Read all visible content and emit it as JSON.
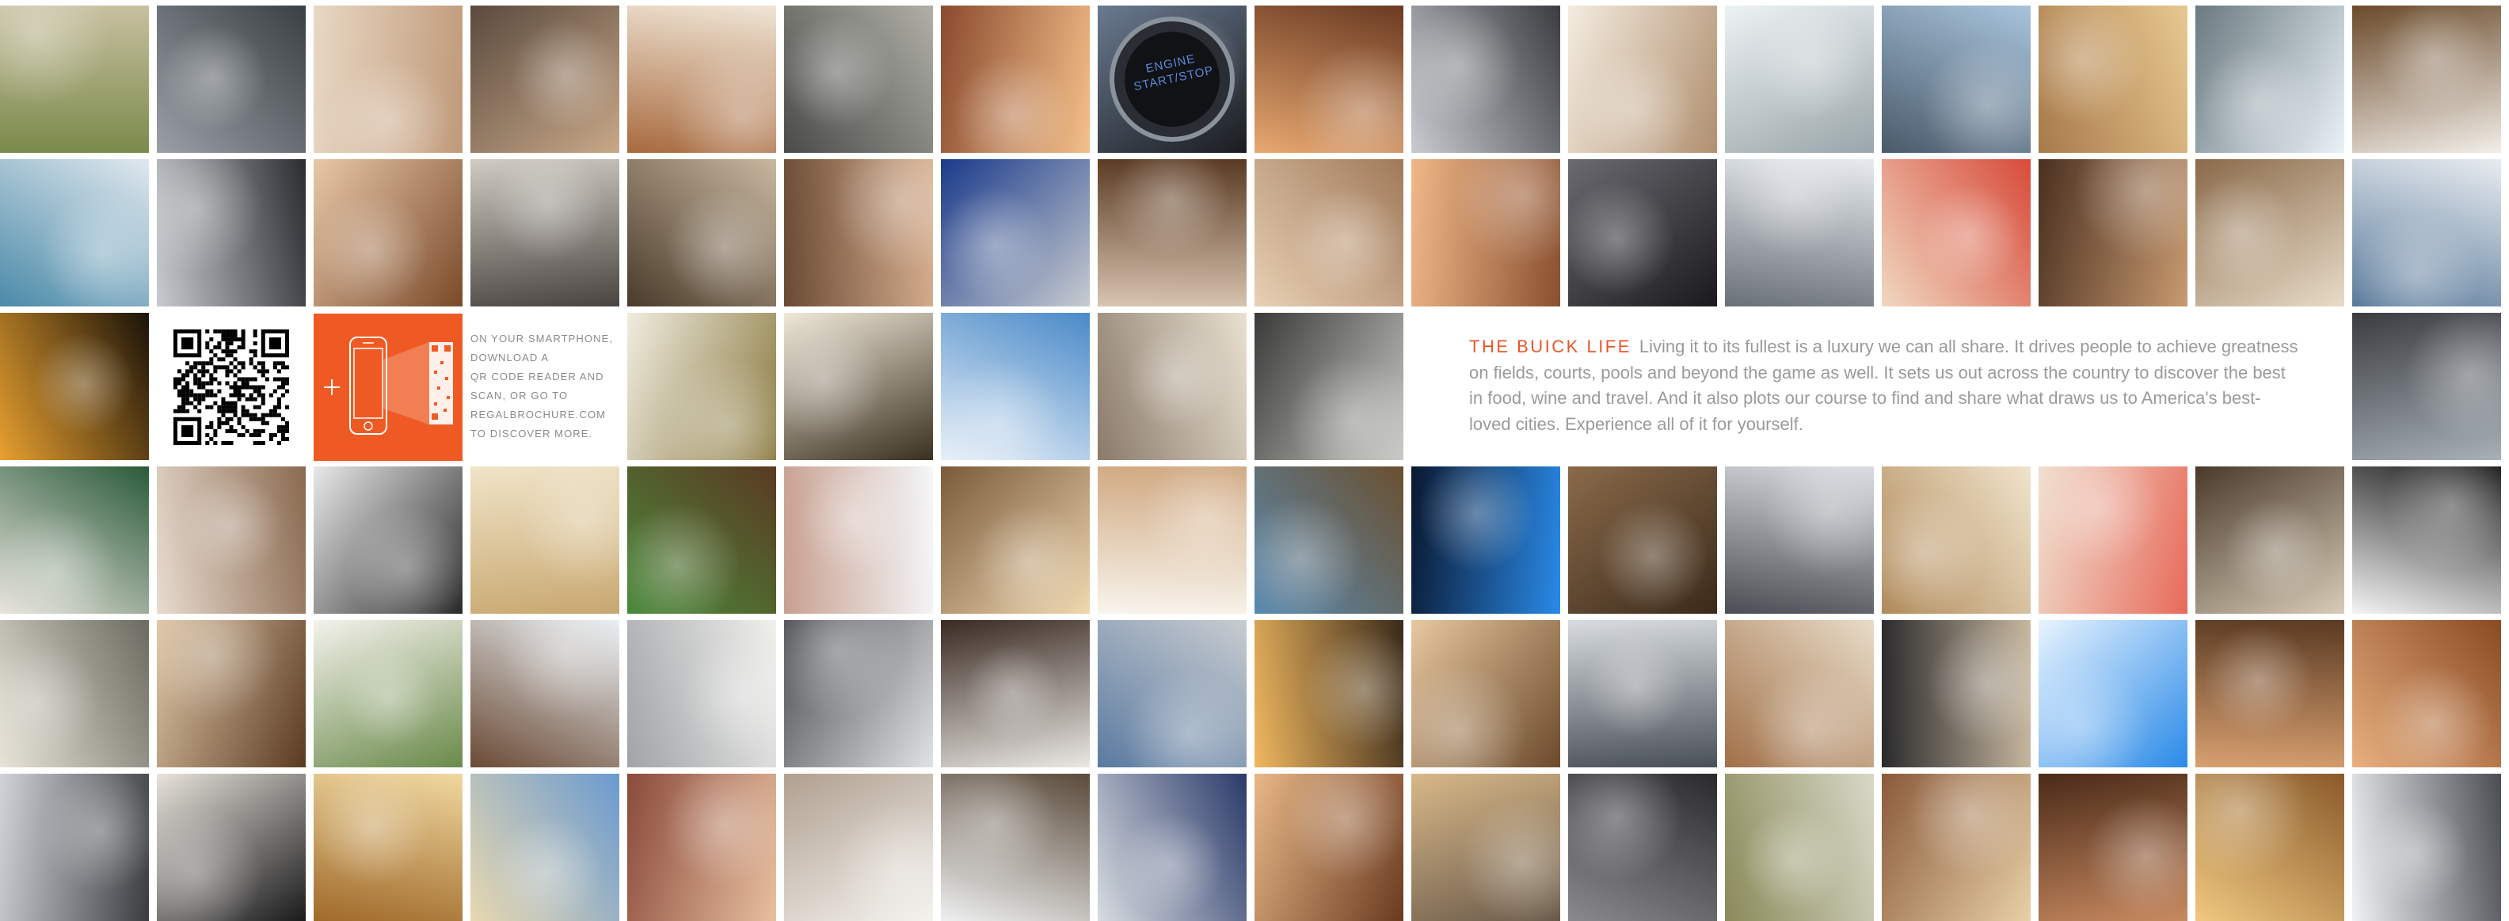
{
  "intro": {
    "title": "THE BUICK LIFE",
    "body": "Living it to its fullest is a luxury we can all share. It drives people to achieve greatness on fields, courts, pools and beyond the game as well. It sets us out across the country to discover the best in food, wine and travel. And it also plots our course to find and share what draws us to America's best-loved cities. Experience all of it for yourself."
  },
  "qr_promo": {
    "instructions": "ON YOUR SMARTPHONE,\nDOWNLOAD A\nQR CODE READER AND\nSCAN, OR GO TO\nREGALBROCHURE.COM\nTO DISCOVER MORE."
  },
  "engine_button": {
    "line1": "ENGINE",
    "line2": "START/STOP"
  },
  "colors": {
    "accent": "#e8562a",
    "promo_tile": "#ef5a24",
    "body_text": "#9a9a9a"
  },
  "photos": [
    {
      "row": 0,
      "col": 0,
      "subject": "blurred trees",
      "tone": [
        "#7a8a4a",
        "#c8c0a0"
      ]
    },
    {
      "row": 0,
      "col": 1,
      "subject": "car grille",
      "tone": [
        "#9aa0a6",
        "#3a3f44"
      ]
    },
    {
      "row": 0,
      "col": 2,
      "subject": "starfish on hand",
      "tone": [
        "#e8d8c4",
        "#c09a7a"
      ]
    },
    {
      "row": 0,
      "col": 3,
      "subject": "couple in car",
      "tone": [
        "#5a4a3e",
        "#c8a888"
      ]
    },
    {
      "row": 0,
      "col": 4,
      "subject": "beach umbrella",
      "tone": [
        "#f0e6d6",
        "#a86a3e"
      ]
    },
    {
      "row": 0,
      "col": 5,
      "subject": "pebbles",
      "tone": [
        "#b0b0a8",
        "#4a4a48"
      ]
    },
    {
      "row": 0,
      "col": 6,
      "subject": "woman sunlight",
      "tone": [
        "#f4c08a",
        "#8a4a2e"
      ]
    },
    {
      "row": 0,
      "col": 7,
      "subject": "engine start button",
      "tone": [
        "#1a1c20",
        "#6a7a90"
      ]
    },
    {
      "row": 0,
      "col": 8,
      "subject": "smiling woman",
      "tone": [
        "#e8a870",
        "#6a3a22"
      ]
    },
    {
      "row": 0,
      "col": 9,
      "subject": "car rear",
      "tone": [
        "#c8ccd0",
        "#3a3c40"
      ]
    },
    {
      "row": 0,
      "col": 10,
      "subject": "couple sitting",
      "tone": [
        "#f4ece0",
        "#b09070"
      ]
    },
    {
      "row": 0,
      "col": 11,
      "subject": "woman in field",
      "tone": [
        "#eef2f4",
        "#9aa6aa"
      ]
    },
    {
      "row": 0,
      "col": 12,
      "subject": "city skyline",
      "tone": [
        "#a8c4dc",
        "#4a5a6a"
      ]
    },
    {
      "row": 0,
      "col": 13,
      "subject": "woman portrait",
      "tone": [
        "#e8c890",
        "#a87a4a"
      ]
    },
    {
      "row": 0,
      "col": 14,
      "subject": "man on beach",
      "tone": [
        "#eaf2f8",
        "#6a7a80"
      ]
    },
    {
      "row": 0,
      "col": 15,
      "subject": "seafood plate",
      "tone": [
        "#f2eee8",
        "#6a4a2a"
      ]
    },
    {
      "row": 1,
      "col": 0,
      "subject": "canoe on lake",
      "tone": [
        "#4a8aa8",
        "#e0e8ee"
      ]
    },
    {
      "row": 1,
      "col": 1,
      "subject": "buick emblem",
      "tone": [
        "#c8ccd0",
        "#2a2c30"
      ]
    },
    {
      "row": 1,
      "col": 2,
      "subject": "woman hair",
      "tone": [
        "#e8c8a8",
        "#7a4a2a"
      ]
    },
    {
      "row": 1,
      "col": 3,
      "subject": "car interior",
      "tone": [
        "#d0ccc4",
        "#4a4440"
      ]
    },
    {
      "row": 1,
      "col": 4,
      "subject": "woman outdoors",
      "tone": [
        "#c8b8a0",
        "#4a3a2a"
      ]
    },
    {
      "row": 1,
      "col": 5,
      "subject": "face closeup",
      "tone": [
        "#d8b090",
        "#6a4a34"
      ]
    },
    {
      "row": 1,
      "col": 6,
      "subject": "headlight",
      "tone": [
        "#c8ccd0",
        "#1a3a8a"
      ]
    },
    {
      "row": 1,
      "col": 7,
      "subject": "laughing woman",
      "tone": [
        "#d8c4b0",
        "#5a3a22"
      ]
    },
    {
      "row": 1,
      "col": 8,
      "subject": "feet in sand",
      "tone": [
        "#e8d0b4",
        "#a07a5a"
      ]
    },
    {
      "row": 1,
      "col": 9,
      "subject": "smiling woman",
      "tone": [
        "#f0b888",
        "#8a5030"
      ]
    },
    {
      "row": 1,
      "col": 10,
      "subject": "grille emblem",
      "tone": [
        "#6a6a70",
        "#1a1a1e"
      ]
    },
    {
      "row": 1,
      "col": 11,
      "subject": "car front",
      "tone": [
        "#e8ecf0",
        "#6a7078"
      ]
    },
    {
      "row": 1,
      "col": 12,
      "subject": "girl watermelon",
      "tone": [
        "#d84a3a",
        "#f0d8c0"
      ]
    },
    {
      "row": 1,
      "col": 13,
      "subject": "smiling man",
      "tone": [
        "#c89a70",
        "#4a3020"
      ]
    },
    {
      "row": 1,
      "col": 14,
      "subject": "couple walking",
      "tone": [
        "#e8dcc8",
        "#8a6a4a"
      ]
    },
    {
      "row": 1,
      "col": 15,
      "subject": "mountains",
      "tone": [
        "#5a7a9a",
        "#e8ecf0"
      ]
    },
    {
      "row": 2,
      "col": 0,
      "subject": "sunset silhouettes",
      "tone": [
        "#e8a030",
        "#1a1208"
      ]
    },
    {
      "row": 2,
      "col": 4,
      "subject": "bowl of food",
      "tone": [
        "#f0ece0",
        "#8a7a40"
      ]
    },
    {
      "row": 2,
      "col": 5,
      "subject": "woman in hammock",
      "tone": [
        "#f0e8d8",
        "#3a3020"
      ]
    },
    {
      "row": 2,
      "col": 6,
      "subject": "sky and building",
      "tone": [
        "#4a8ac8",
        "#e8f0f8"
      ]
    },
    {
      "row": 2,
      "col": 7,
      "subject": "car driving",
      "tone": [
        "#e8e0d0",
        "#8a7a6a"
      ]
    },
    {
      "row": 2,
      "col": 8,
      "subject": "shadow on rocks",
      "tone": [
        "#c8c8c4",
        "#3a3a38"
      ]
    },
    {
      "row": 2,
      "col": 15,
      "subject": "car on road",
      "tone": [
        "#a8b0b8",
        "#3a3c40"
      ]
    },
    {
      "row": 3,
      "col": 0,
      "subject": "friends in hats",
      "tone": [
        "#e8e4dc",
        "#2a5a3a"
      ]
    },
    {
      "row": 3,
      "col": 1,
      "subject": "bearded man",
      "tone": [
        "#e8dcd0",
        "#8a6a50"
      ]
    },
    {
      "row": 3,
      "col": 2,
      "subject": "steering wheel",
      "tone": [
        "#e8e8e8",
        "#2a2a2c"
      ]
    },
    {
      "row": 3,
      "col": 3,
      "subject": "desert field",
      "tone": [
        "#f0e4c8",
        "#c8a870"
      ]
    },
    {
      "row": 3,
      "col": 4,
      "subject": "chopping herbs",
      "tone": [
        "#5a3a22",
        "#4a8a3a"
      ]
    },
    {
      "row": 3,
      "col": 5,
      "subject": "dragonfly on finger",
      "tone": [
        "#f4f6f8",
        "#c8a090"
      ]
    },
    {
      "row": 3,
      "col": 6,
      "subject": "couple sunset",
      "tone": [
        "#f0d8b0",
        "#7a5a3a"
      ]
    },
    {
      "row": 3,
      "col": 7,
      "subject": "woman looking away",
      "tone": [
        "#f8f4ec",
        "#d0a880"
      ]
    },
    {
      "row": 3,
      "col": 8,
      "subject": "rock coast",
      "tone": [
        "#5a8ab0",
        "#6a5030"
      ]
    },
    {
      "row": 3,
      "col": 9,
      "subject": "gauge cluster",
      "tone": [
        "#0a1830",
        "#2a8ae8"
      ]
    },
    {
      "row": 3,
      "col": 10,
      "subject": "open book",
      "tone": [
        "#8a6a4a",
        "#3a2a1a"
      ]
    },
    {
      "row": 3,
      "col": 11,
      "subject": "alloy wheel",
      "tone": [
        "#d8dce0",
        "#4a4e54"
      ]
    },
    {
      "row": 3,
      "col": 12,
      "subject": "couple walking",
      "tone": [
        "#f0e4cc",
        "#b08a5a"
      ]
    },
    {
      "row": 3,
      "col": 13,
      "subject": "girl watermelon",
      "tone": [
        "#e86a5a",
        "#f0e0d0"
      ]
    },
    {
      "row": 3,
      "col": 14,
      "subject": "clothes line",
      "tone": [
        "#d8ccb8",
        "#4a3a2a"
      ]
    },
    {
      "row": 3,
      "col": 15,
      "subject": "leather seat",
      "tone": [
        "#f4f4f4",
        "#1a1a1c"
      ]
    },
    {
      "row": 4,
      "col": 0,
      "subject": "car by trees",
      "tone": [
        "#e8e4d8",
        "#6a6a60"
      ]
    },
    {
      "row": 4,
      "col": 1,
      "subject": "couple with phone",
      "tone": [
        "#e0c8a8",
        "#5a3a22"
      ]
    },
    {
      "row": 4,
      "col": 2,
      "subject": "dessert plate",
      "tone": [
        "#f4f2ec",
        "#6a8a4a"
      ]
    },
    {
      "row": 4,
      "col": 3,
      "subject": "man portrait",
      "tone": [
        "#e8eef2",
        "#6a4a34"
      ]
    },
    {
      "row": 4,
      "col": 4,
      "subject": "car at sea",
      "tone": [
        "#f0f0ec",
        "#a0a4a8"
      ]
    },
    {
      "row": 4,
      "col": 5,
      "subject": "speaker grille",
      "tone": [
        "#e0e2e4",
        "#4a4c50"
      ]
    },
    {
      "row": 4,
      "col": 6,
      "subject": "woman in wind",
      "tone": [
        "#eae8e4",
        "#3a2a22"
      ]
    },
    {
      "row": 4,
      "col": 7,
      "subject": "car side",
      "tone": [
        "#5a7aa0",
        "#c8ccd0"
      ]
    },
    {
      "row": 4,
      "col": 8,
      "subject": "car at sunset",
      "tone": [
        "#f0b860",
        "#3a2a1a"
      ]
    },
    {
      "row": 4,
      "col": 9,
      "subject": "laughing couple",
      "tone": [
        "#e8c8a0",
        "#6a4a2a"
      ]
    },
    {
      "row": 4,
      "col": 10,
      "subject": "car and turbines",
      "tone": [
        "#d8dce0",
        "#4a5058"
      ]
    },
    {
      "row": 4,
      "col": 11,
      "subject": "road motion",
      "tone": [
        "#e8dcc8",
        "#a07048"
      ]
    },
    {
      "row": 4,
      "col": 12,
      "subject": "dashboard",
      "tone": [
        "#c8b8a0",
        "#2a2a2c"
      ]
    },
    {
      "row": 4,
      "col": 13,
      "subject": "sun in sky",
      "tone": [
        "#2a8ae8",
        "#e8f4ff"
      ]
    },
    {
      "row": 4,
      "col": 14,
      "subject": "smiling man",
      "tone": [
        "#d8a070",
        "#5a3a22"
      ]
    },
    {
      "row": 4,
      "col": 15,
      "subject": "woman red hair",
      "tone": [
        "#e8b080",
        "#8a4a22"
      ]
    },
    {
      "row": 5,
      "col": 0,
      "subject": "factory floor",
      "tone": [
        "#d0d4d8",
        "#3a3c40"
      ]
    },
    {
      "row": 5,
      "col": 1,
      "subject": "chef cooking",
      "tone": [
        "#e8e4dc",
        "#1a1a1c"
      ]
    },
    {
      "row": 5,
      "col": 2,
      "subject": "sunset building",
      "tone": [
        "#f0d8a0",
        "#a06a2a"
      ]
    },
    {
      "row": 5,
      "col": 3,
      "subject": "wheat stalks",
      "tone": [
        "#6a9ad0",
        "#e8d8b0"
      ]
    },
    {
      "row": 5,
      "col": 4,
      "subject": "woman driving",
      "tone": [
        "#e8c0a0",
        "#8a4a3a"
      ]
    },
    {
      "row": 5,
      "col": 5,
      "subject": "seat headrest",
      "tone": [
        "#f4f2ee",
        "#b0a090"
      ]
    },
    {
      "row": 5,
      "col": 6,
      "subject": "man driving",
      "tone": [
        "#eef0f0",
        "#5a4a3a"
      ]
    },
    {
      "row": 5,
      "col": 7,
      "subject": "headlamp",
      "tone": [
        "#d8dce0",
        "#2a3a6a"
      ]
    },
    {
      "row": 5,
      "col": 8,
      "subject": "woman smiling",
      "tone": [
        "#e8b888",
        "#6a3a20"
      ]
    },
    {
      "row": 5,
      "col": 9,
      "subject": "car in canyon",
      "tone": [
        "#d8b888",
        "#6a5a4a"
      ]
    },
    {
      "row": 5,
      "col": 10,
      "subject": "gear shifter",
      "tone": [
        "#2a2a2c",
        "#8a8a8e"
      ]
    },
    {
      "row": 5,
      "col": 11,
      "subject": "blurred trees",
      "tone": [
        "#d8d8c8",
        "#8a8a5a"
      ]
    },
    {
      "row": 5,
      "col": 12,
      "subject": "tall building",
      "tone": [
        "#e8d0a8",
        "#8a5a3a"
      ]
    },
    {
      "row": 5,
      "col": 13,
      "subject": "smiling man",
      "tone": [
        "#c88a60",
        "#4a2a18"
      ]
    },
    {
      "row": 5,
      "col": 14,
      "subject": "woman backlit",
      "tone": [
        "#f0c880",
        "#8a5a2a"
      ]
    },
    {
      "row": 5,
      "col": 15,
      "subject": "water ripple",
      "tone": [
        "#f0f2f4",
        "#4a4e54"
      ]
    }
  ]
}
